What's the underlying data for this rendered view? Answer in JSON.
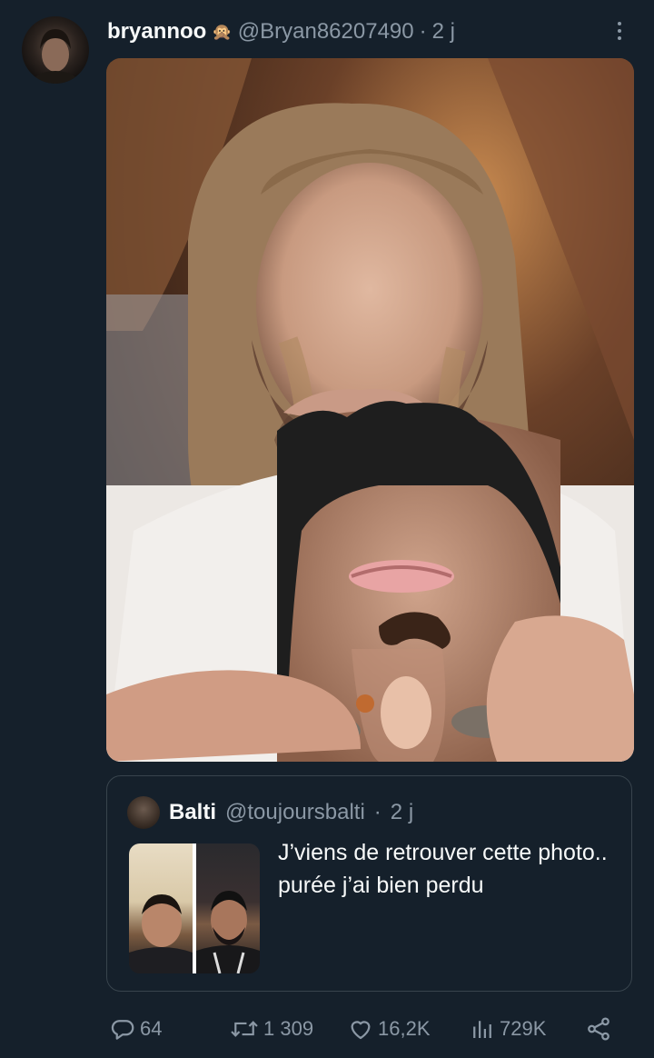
{
  "tweet": {
    "author_name": "bryannoo",
    "author_emoji": "🙊",
    "handle": "@Bryan86207490",
    "separator": "·",
    "time": "2 j"
  },
  "quoted_tweet": {
    "author_name": "Balti",
    "handle": "@toujoursbalti",
    "separator": "·",
    "time": "2 j",
    "text": "J’viens de retrouver cette photo.. purée j’ai bien perdu"
  },
  "actions": {
    "replies": "64",
    "retweets": "1 309",
    "likes": "16,2K",
    "views": "729K"
  },
  "icons": [
    "more-icon",
    "reply-icon",
    "retweet-icon",
    "like-icon",
    "views-icon",
    "share-icon"
  ],
  "colors": {
    "background": "#15202b",
    "text": "#f7f9f9",
    "secondary_text": "#8b98a5",
    "border": "#38444d"
  }
}
